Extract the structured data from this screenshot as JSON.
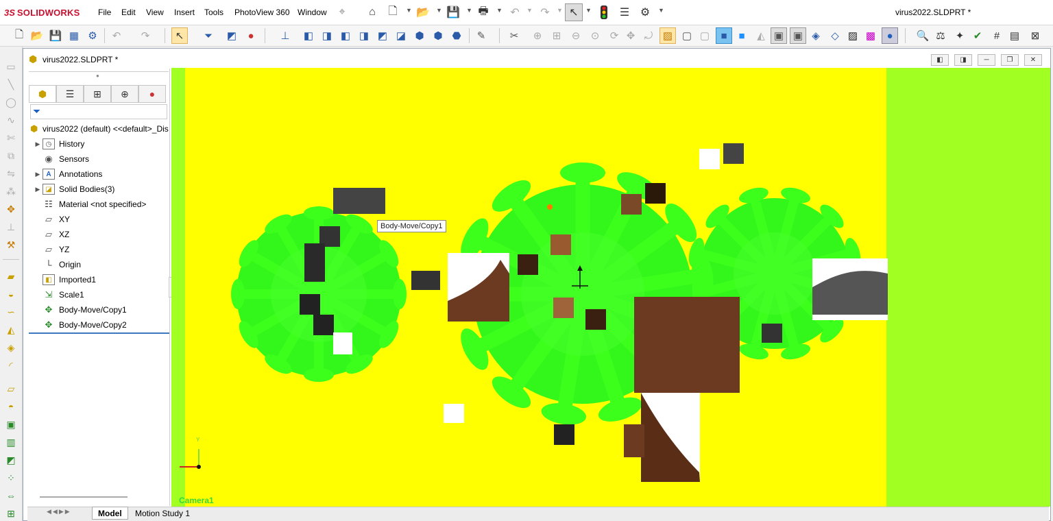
{
  "app": {
    "brand_ds": "3S",
    "brand_name": "SOLIDWORKS",
    "window_title": "virus2022.SLDPRT *"
  },
  "menu": {
    "items": [
      "File",
      "Edit",
      "View",
      "Insert",
      "Tools",
      "PhotoView 360",
      "Window"
    ]
  },
  "document": {
    "title": "virus2022.SLDPRT *"
  },
  "feature_tree": {
    "root": "virus2022 (default) <<default>_Dis",
    "items": [
      {
        "label": "History",
        "expandable": true,
        "icon": "history-icon"
      },
      {
        "label": "Sensors",
        "expandable": false,
        "icon": "sensors-icon"
      },
      {
        "label": "Annotations",
        "expandable": true,
        "icon": "annotations-icon"
      },
      {
        "label": "Solid Bodies(3)",
        "expandable": true,
        "icon": "solid-bodies-icon"
      },
      {
        "label": "Material <not specified>",
        "expandable": false,
        "icon": "material-icon"
      },
      {
        "label": "XY",
        "expandable": false,
        "icon": "plane-icon"
      },
      {
        "label": "XZ",
        "expandable": false,
        "icon": "plane-icon"
      },
      {
        "label": "YZ",
        "expandable": false,
        "icon": "plane-icon"
      },
      {
        "label": "Origin",
        "expandable": false,
        "icon": "origin-icon"
      },
      {
        "label": "Imported1",
        "expandable": false,
        "icon": "imported-icon"
      },
      {
        "label": "Scale1",
        "expandable": false,
        "icon": "scale-icon"
      },
      {
        "label": "Body-Move/Copy1",
        "expandable": false,
        "icon": "body-move-icon"
      },
      {
        "label": "Body-Move/Copy2",
        "expandable": false,
        "icon": "body-move-icon"
      }
    ]
  },
  "viewport": {
    "tooltip": "Body-Move/Copy1",
    "view_label": "Camera1",
    "axis_y": "Y"
  },
  "bottom_tabs": [
    "Model",
    "Motion Study 1"
  ],
  "colors": {
    "background": "#a2ff22",
    "model_area": "#ffff00",
    "virus_green": "#33ff1a",
    "brand": "#c8102e"
  }
}
